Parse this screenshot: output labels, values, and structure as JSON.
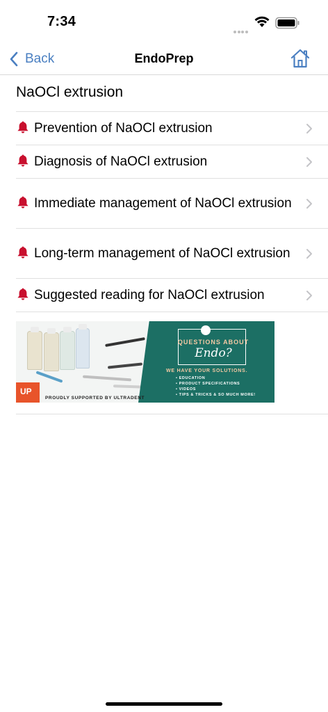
{
  "status_bar": {
    "time": "7:34"
  },
  "nav": {
    "back_label": "Back",
    "title": "EndoPrep"
  },
  "section": {
    "title": "NaOCl extrusion"
  },
  "menu_items": [
    {
      "label": "Prevention of NaOCl extrusion",
      "icon": "bell-icon"
    },
    {
      "label": "Diagnosis of NaOCl extrusion",
      "icon": "bell-icon"
    },
    {
      "label": "Immediate management of NaOCl extrusion",
      "icon": "bell-icon"
    },
    {
      "label": "Long-term management of NaOCl extrusion",
      "icon": "bell-icon"
    },
    {
      "label": "Suggested reading for NaOCl extrusion",
      "icon": "bell-icon"
    }
  ],
  "banner": {
    "headline_top": "QUESTIONS ABOUT",
    "headline_main": "Endo?",
    "subheading": "WE HAVE YOUR SOLUTIONS.",
    "bullets": [
      "EDUCATION",
      "PRODUCT SPECIFICATIONS",
      "VIDEOS",
      "TIPS & TRICKS & SO MUCH MORE!"
    ],
    "support_text": "PROUDLY SUPPORTED BY ULTRADENT",
    "logo_text": "UP"
  },
  "colors": {
    "accent": "#4a7fc1",
    "bell": "#c8102e",
    "banner_green": "#1c6f64"
  }
}
